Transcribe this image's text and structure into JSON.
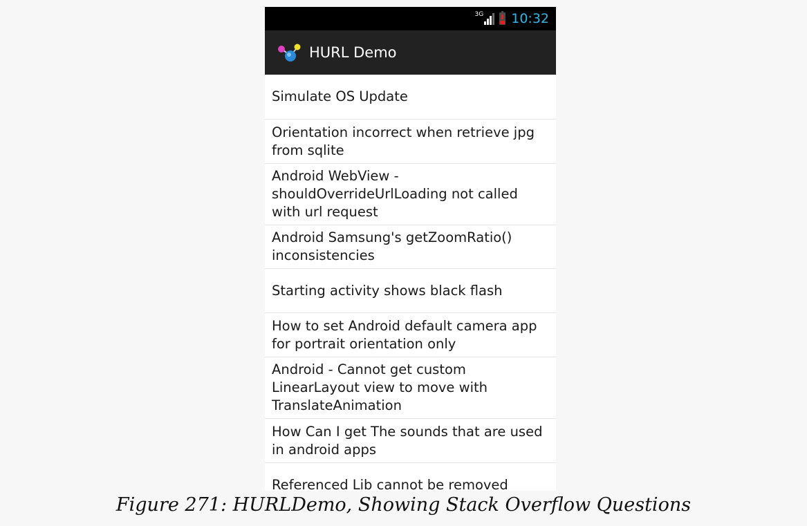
{
  "status_bar": {
    "network": "3G",
    "time": "10:32",
    "colors": {
      "time": "#33b5e5",
      "battery_low": "#e02020"
    }
  },
  "action_bar": {
    "app_icon": "hurl-app-icon",
    "title": "HURL Demo"
  },
  "questions": [
    "Simulate OS Update",
    "Orientation incorrect when retrieve jpg from sqlite",
    "Android WebView - shouldOverrideUrlLoading not called with url request",
    "Android Samsung's getZoomRatio() inconsistencies",
    "Starting activity shows black flash",
    "How to set Android default camera app for portrait orientation only",
    "Android - Cannot get custom LinearLayout view to move with TranslateAnimation",
    "How Can I get The sounds that are used in android apps",
    "Referenced Lib cannot be removed"
  ],
  "caption": "Figure 271: HURLDemo, Showing Stack Overflow Questions"
}
